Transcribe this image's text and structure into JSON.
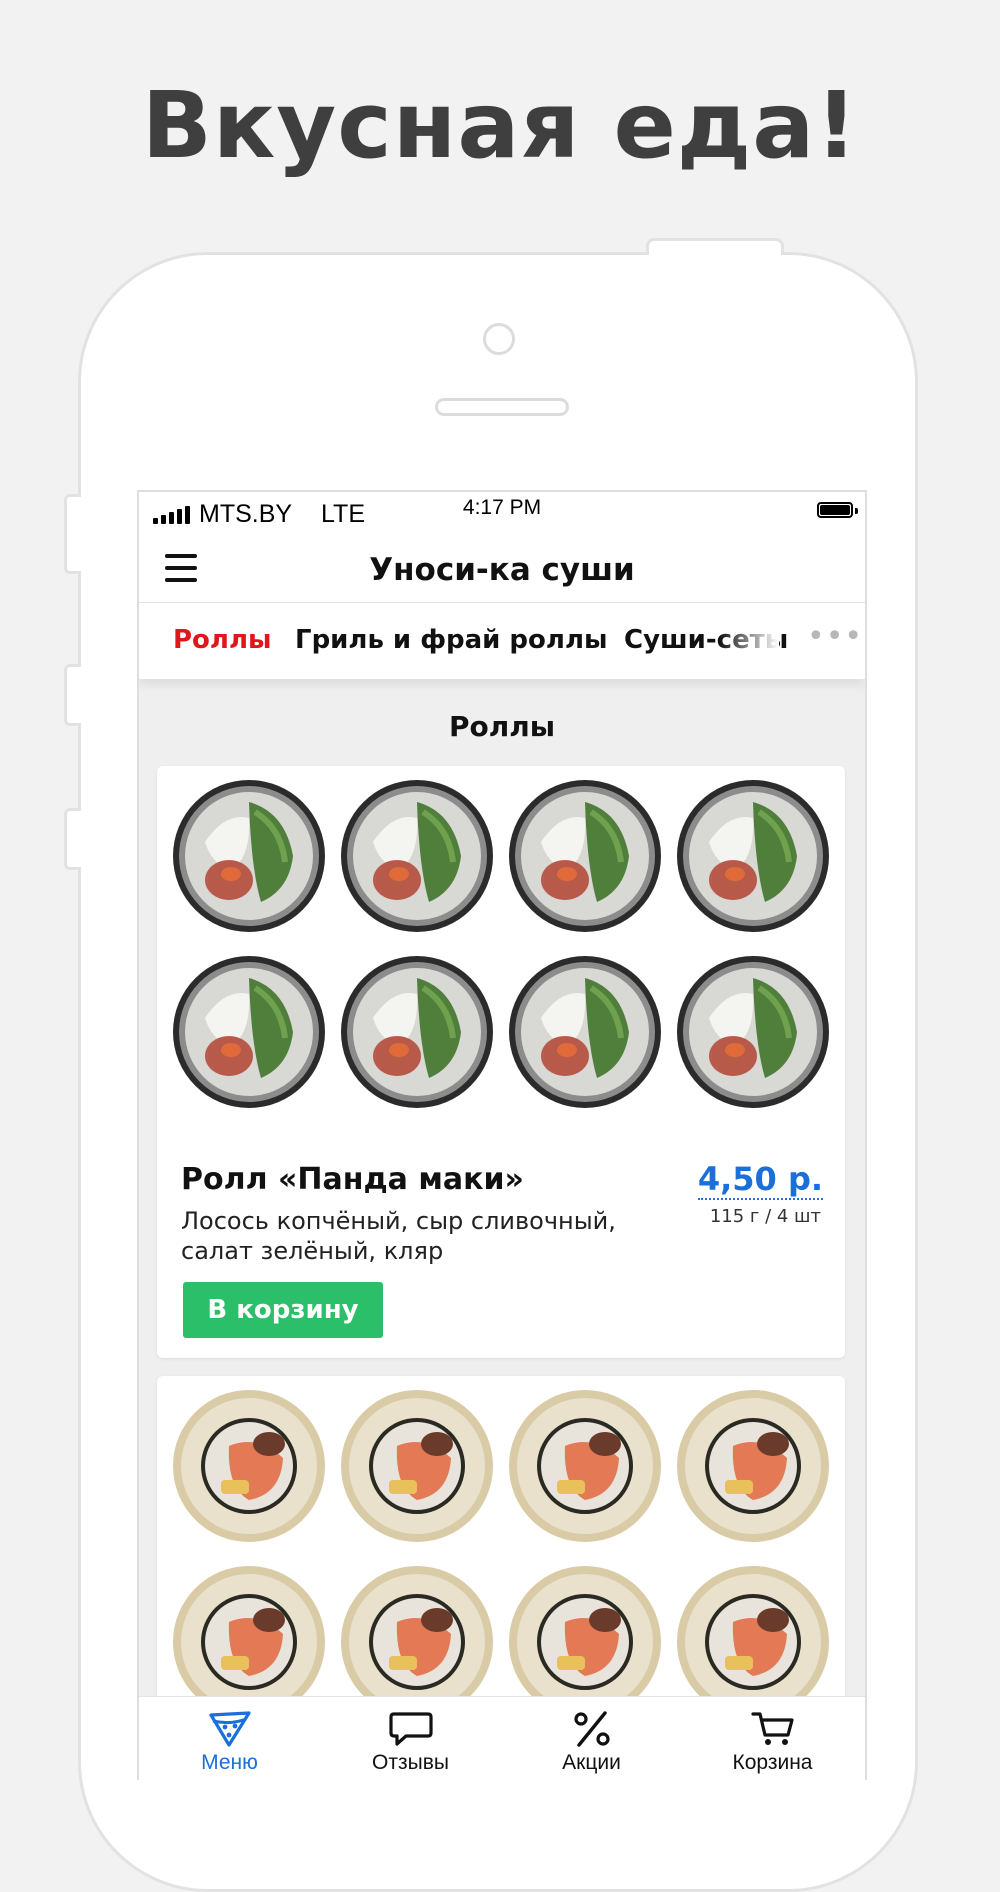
{
  "headline": "Вкусная еда!",
  "statusbar": {
    "carrier": "MTS.BY",
    "network": "LTE",
    "time": "4:17 PM"
  },
  "navbar": {
    "title": "Уноси-ка суши"
  },
  "categories": [
    {
      "label": "Роллы",
      "active": true
    },
    {
      "label": "Гриль и фрай роллы",
      "active": false
    },
    {
      "label": "Суши-сеты",
      "active": false
    }
  ],
  "section_title": "Роллы",
  "products": [
    {
      "name": "Ролл «Панда маки»",
      "description": "Лосось копчёный, сыр сливочный, салат зелёный, кляр",
      "price": "4,50 р.",
      "weight": "115 г / 4 шт",
      "button_label": "В корзину"
    }
  ],
  "tabbar": [
    {
      "label": "Меню",
      "icon": "pizza-slice-icon",
      "active": true
    },
    {
      "label": "Отзывы",
      "icon": "speech-bubble-icon",
      "active": false
    },
    {
      "label": "Акции",
      "icon": "percent-icon",
      "active": false
    },
    {
      "label": "Корзина",
      "icon": "shopping-cart-icon",
      "active": false
    }
  ],
  "colors": {
    "accent_red": "#e0161b",
    "price_blue": "#1a6fd8",
    "button_green": "#2cbf6a",
    "headline_gray": "#3f3f3f"
  }
}
